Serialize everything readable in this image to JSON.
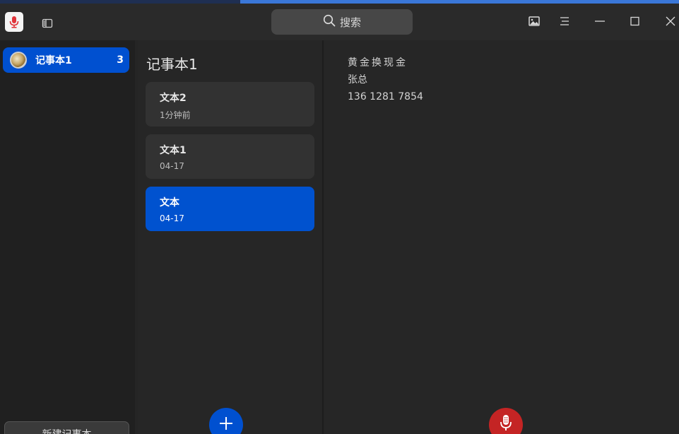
{
  "window": {
    "search_label": "搜索",
    "icons": {
      "app": "microphone-app-icon",
      "sidebar_toggle": "sidebar-toggle-icon",
      "image": "image-icon",
      "menu": "menu-icon",
      "minimize": "minimize-icon",
      "maximize": "maximize-icon",
      "close": "close-icon"
    }
  },
  "sidebar": {
    "notebooks": [
      {
        "label": "记事本1",
        "count": "3"
      }
    ],
    "new_notebook_label": "新建记事本"
  },
  "note_list": {
    "title": "记事本1",
    "notes": [
      {
        "title": "文本2",
        "date": "1分钟前"
      },
      {
        "title": "文本1",
        "date": "04-17"
      },
      {
        "title": "文本",
        "date": "04-17"
      }
    ],
    "active_index": 2
  },
  "editor": {
    "lines": [
      "黄金换现金",
      "张总",
      "136 1281 7854"
    ]
  },
  "colors": {
    "accent": "#0050d0",
    "record": "#c42424",
    "background": "#252525"
  }
}
